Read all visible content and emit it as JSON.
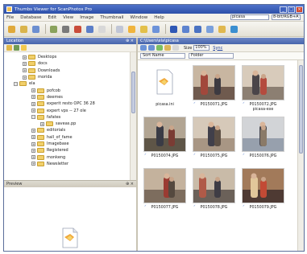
{
  "window": {
    "title": "Thumbs Viewer for ScanPhotos Pro",
    "minimize": "_",
    "maximize": "□",
    "close": "×"
  },
  "menu": {
    "items": [
      "File",
      "Database",
      "Edit",
      "View",
      "Image",
      "Thumbnail",
      "Window",
      "Help"
    ],
    "search_value": "picasa",
    "search2_value": "8-bit/RGB+A"
  },
  "toolbar": {
    "buttons": [
      {
        "icon": "open-icon",
        "color": "#e0a93a"
      },
      {
        "icon": "folder-icon",
        "color": "#d9b44c"
      },
      {
        "icon": "disc-icon",
        "color": "#6c8fd0"
      },
      {
        "icon": "scanner-icon",
        "color": "#8aa25c"
      },
      {
        "icon": "print-icon",
        "color": "#7a7a7a"
      },
      {
        "icon": "red-eye-icon",
        "color": "#c94c3a"
      },
      {
        "icon": "crop-icon",
        "color": "#5b7ec8"
      },
      {
        "icon": "page-icon",
        "color": "#d8d8d8"
      },
      {
        "icon": "select-icon",
        "color": "#c0c6d6"
      },
      {
        "icon": "star-icon",
        "color": "#f0b43c"
      },
      {
        "icon": "sharpen-icon",
        "color": "#e3c04a"
      },
      {
        "icon": "rotate-icon",
        "color": "#6d93d9"
      },
      {
        "icon": "help-icon",
        "color": "#2f58b5"
      },
      {
        "icon": "play-icon",
        "color": "#5d83cf"
      },
      {
        "icon": "slideshow-icon",
        "color": "#4a72c2"
      },
      {
        "icon": "resize-icon",
        "color": "#7aa0dc"
      },
      {
        "icon": "email-icon",
        "color": "#e0b84f"
      },
      {
        "icon": "globe-icon",
        "color": "#3b8fd0"
      }
    ]
  },
  "locations": {
    "title": "Location",
    "ctrl": "⊕ ×",
    "tree": [
      {
        "label": "Desktops",
        "level": 3
      },
      {
        "label": "docs",
        "level": 3
      },
      {
        "label": "Downloads",
        "level": 3
      },
      {
        "label": "morida",
        "level": 3
      },
      {
        "label": "ela",
        "level": 2
      },
      {
        "label": "pofcob",
        "level": 4
      },
      {
        "label": "deemes",
        "level": 4
      },
      {
        "label": "experit resto OPC 36 28",
        "level": 4
      },
      {
        "label": "expert vps -- 27 ole",
        "level": 4
      },
      {
        "label": "fafates",
        "level": 4
      },
      {
        "label": "saveas.pp",
        "level": 5
      },
      {
        "label": "editorials",
        "level": 4
      },
      {
        "label": "hall_of_fame",
        "level": 4
      },
      {
        "label": "Imagebase",
        "level": 4
      },
      {
        "label": "Registered",
        "level": 4
      },
      {
        "label": "monkeng",
        "level": 4
      },
      {
        "label": "Newsletter",
        "level": 4
      }
    ]
  },
  "preview": {
    "title": "Preview",
    "ctrl": "⊕ ×"
  },
  "browser": {
    "title": "C:\\Users\\ela\\picasa",
    "size_label": "Size",
    "size_value": "100%",
    "view_label": "Sync",
    "sort_value": "Sort Name",
    "filter_value": "Folder",
    "thumbnails": [
      {
        "name": "picasa.ini",
        "sub": "",
        "kind": "file"
      },
      {
        "name": "P0150071.JPG",
        "sub": "",
        "kind": "photo",
        "palette": [
          "#6f5a4e",
          "#c8b6a1",
          "#3d3a41",
          "#a2483c"
        ]
      },
      {
        "name": "P0150072.JPG",
        "sub": "picasa-exe",
        "kind": "photo",
        "palette": [
          "#8c7f72",
          "#d8cbbb",
          "#b44b3e",
          "#4a4549"
        ]
      },
      {
        "name": "P0150074.JPG",
        "sub": "",
        "kind": "photo",
        "palette": [
          "#5e5547",
          "#b2a593",
          "#7a3c34",
          "#3a3b45"
        ]
      },
      {
        "name": "P0150075.JPG",
        "sub": "",
        "kind": "photo",
        "palette": [
          "#a89684",
          "#d6c9b9",
          "#5c4f44",
          "#403f4a"
        ]
      },
      {
        "name": "P0150076.JPG",
        "sub": "",
        "kind": "photo",
        "palette": [
          "#97a0ad",
          "#d2d4d7",
          "#8a7a68",
          "#45464f"
        ]
      },
      {
        "name": "P0150077.JPG",
        "sub": "",
        "kind": "photo",
        "palette": [
          "#7d6d5e",
          "#c4b29d",
          "#55493f",
          "#9a3b32"
        ]
      },
      {
        "name": "P0150078.JPG",
        "sub": "",
        "kind": "photo",
        "palette": [
          "#6b6159",
          "#c9bba8",
          "#3f3d45",
          "#b05a48"
        ]
      },
      {
        "name": "P0150079.JPG",
        "sub": "",
        "kind": "photo",
        "palette": [
          "#4e3a33",
          "#a27a5a",
          "#c24a35",
          "#e1c79a"
        ]
      }
    ]
  }
}
